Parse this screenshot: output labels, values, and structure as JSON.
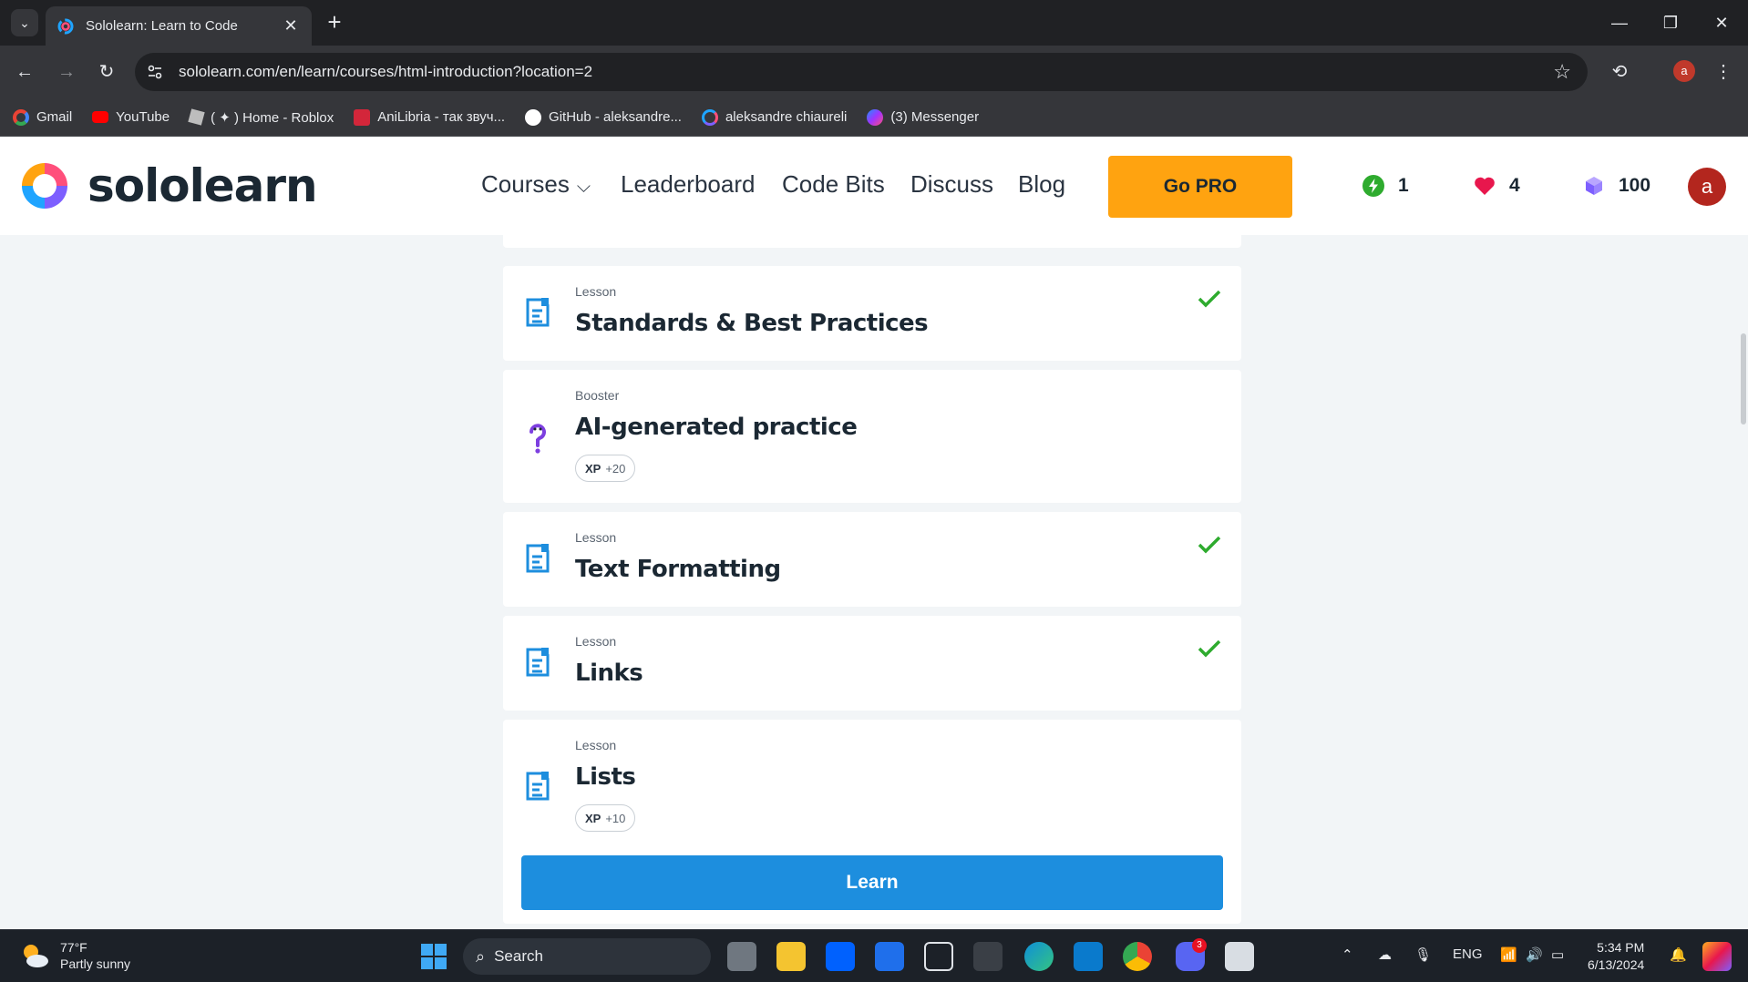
{
  "browser": {
    "tab_title": "Sololearn: Learn to Code",
    "url": "sololearn.com/en/learn/courses/html-introduction?location=2",
    "profile_initial": "a",
    "bookmarks": [
      {
        "label": "Gmail",
        "icon": "google-icon",
        "color": "#ea4335"
      },
      {
        "label": "YouTube",
        "icon": "youtube-icon",
        "color": "#ff0000"
      },
      {
        "label": "( ✦ ) Home - Roblox",
        "icon": "roblox-icon",
        "color": "#bdbdbd"
      },
      {
        "label": "AniLibria - так звуч...",
        "icon": "anilibria-icon",
        "color": "#d3263a"
      },
      {
        "label": "GitHub - aleksandre...",
        "icon": "github-icon",
        "color": "#ffffff"
      },
      {
        "label": "aleksandre chiaureli",
        "icon": "sololearn-icon",
        "color": "#7d5fff"
      },
      {
        "label": "(3) Messenger",
        "icon": "messenger-icon",
        "color": "#a033ff"
      }
    ]
  },
  "header": {
    "logo_text": "sololearn",
    "nav": {
      "courses": "Courses",
      "leaderboard": "Leaderboard",
      "code_bits": "Code Bits",
      "discuss": "Discuss",
      "blog": "Blog"
    },
    "go_pro": "Go PRO",
    "streak": "1",
    "hearts": "4",
    "bits": "100",
    "avatar_initial": "a"
  },
  "cards": [
    {
      "type": "Lesson",
      "title": "Standards & Best Practices",
      "completed": true
    },
    {
      "type": "Booster",
      "title": "AI-generated practice",
      "xp_label": "XP",
      "xp_value": "+20"
    },
    {
      "type": "Lesson",
      "title": "Text Formatting",
      "completed": true
    },
    {
      "type": "Lesson",
      "title": "Links",
      "completed": true
    },
    {
      "type": "Lesson",
      "title": "Lists",
      "xp_label": "XP",
      "xp_value": "+10"
    }
  ],
  "learn_button": "Learn",
  "taskbar": {
    "weather_temp": "77°F",
    "weather_desc": "Partly sunny",
    "search_placeholder": "Search",
    "discord_badge": "3",
    "language": "ENG",
    "time": "5:34 PM",
    "date": "6/13/2024"
  },
  "colors": {
    "accent_blue": "#1d8ede",
    "go_pro": "#ffa310",
    "check_green": "#2eab2e",
    "lesson_icon": "#1d8ede"
  }
}
